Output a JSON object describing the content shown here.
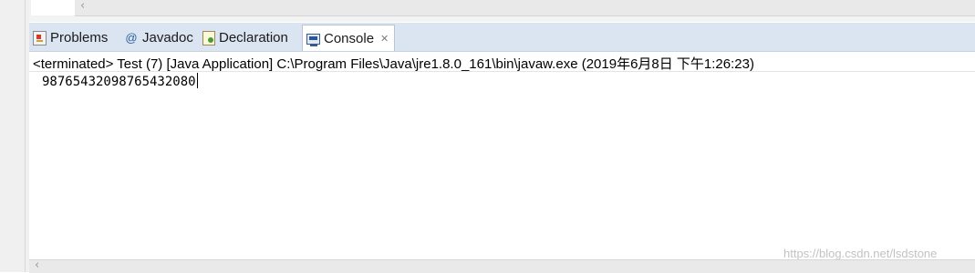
{
  "tabs": [
    {
      "label": "Problems",
      "icon": "problems-icon",
      "active": false
    },
    {
      "label": "Javadoc",
      "icon": "javadoc-icon",
      "active": false
    },
    {
      "label": "Declaration",
      "icon": "declaration-icon",
      "active": false
    },
    {
      "label": "Console",
      "icon": "console-icon",
      "active": true,
      "close_icon": "close-icon"
    }
  ],
  "console": {
    "header": "<terminated> Test (7) [Java Application] C:\\Program Files\\Java\\jre1.8.0_161\\bin\\javaw.exe (2019年6月8日 下午1:26:23)",
    "output": "98765432098765432080"
  },
  "glyphs": {
    "scroll_left_arrow": "‹",
    "javadoc_symbol": "@",
    "close_symbol": "✕"
  },
  "watermark": "https://blog.csdn.net/lsdstone",
  "colors": {
    "tab_bar_background": "#dbe5f1",
    "active_tab_background": "#ffffff",
    "console_background": "#ffffff"
  }
}
